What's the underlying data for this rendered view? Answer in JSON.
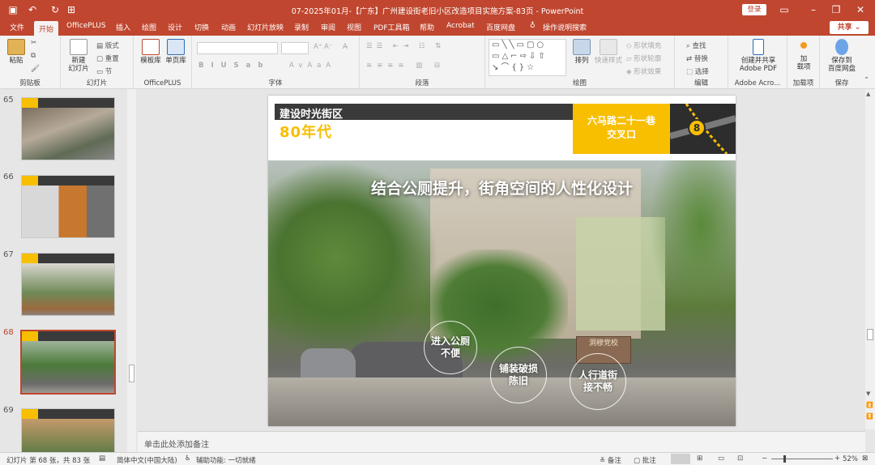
{
  "titlebar": {
    "title": "07-2025年01月-【广东】广州建设街老旧小区改造项目实施方案-83页 - PowerPoint",
    "login": "登录"
  },
  "tabs": [
    "文件",
    "开始",
    "OfficePLUS",
    "插入",
    "绘图",
    "设计",
    "切换",
    "动画",
    "幻灯片放映",
    "录制",
    "审阅",
    "视图",
    "PDF工具箱",
    "帮助",
    "Acrobat",
    "百度网盘"
  ],
  "tell_me": "操作说明搜索",
  "share": "共享",
  "ribbon": {
    "clipboard": {
      "paste": "粘贴",
      "label": "剪贴板"
    },
    "slides": {
      "new_slide_1": "新建",
      "new_slide_2": "幻灯片",
      "layout": "版式",
      "reset": "重置",
      "section": "节",
      "label": "幻灯片"
    },
    "officeplus": {
      "template": "模板库",
      "single": "单页库",
      "label": "OfficePLUS"
    },
    "font": {
      "label": "字体"
    },
    "paragraph": {
      "label": "段落"
    },
    "drawing": {
      "arrange": "排列",
      "quick_styles": "快速样式",
      "fill": "形状填充",
      "outline": "形状轮廓",
      "effect": "形状效果",
      "label": "绘图"
    },
    "editing": {
      "find": "查找",
      "replace": "替换",
      "select": "选择",
      "label": "编辑"
    },
    "adobe": {
      "line1": "创建并共享",
      "line2": "Adobe PDF",
      "label": "Adobe Acro..."
    },
    "addins": {
      "line1": "加",
      "line2": "载项",
      "label": "加载项"
    },
    "save": {
      "line1": "保存到",
      "line2": "百度网盘",
      "label": "保存"
    }
  },
  "thumbnails": [
    {
      "num": "65"
    },
    {
      "num": "66"
    },
    {
      "num": "67"
    },
    {
      "num": "68"
    },
    {
      "num": "69"
    }
  ],
  "slide": {
    "header_title": "建设时光街区",
    "era": "80年代",
    "location_line1": "六马路二十一巷",
    "location_line2": "交叉口",
    "map_badge": "8",
    "photo_title": "结合公厕提升，街角空间的人性化设计",
    "callouts": [
      "进入公厕\n不便",
      "铺装破损\n陈旧",
      "人行道街\n接不畅"
    ],
    "sign_text": "洞穆党校"
  },
  "notes_placeholder": "单击此处添加备注",
  "status": {
    "slide_info": "幻灯片 第 68 张，共 83 张",
    "language": "简体中文(中国大陆)",
    "accessibility": "辅助功能: 一切就绪",
    "notes": "备注",
    "comments": "批注",
    "zoom": "52%"
  },
  "colors": {
    "accent": "#c0462f",
    "slide_yellow": "#f8be00",
    "slide_dark": "#3a3a3a"
  }
}
